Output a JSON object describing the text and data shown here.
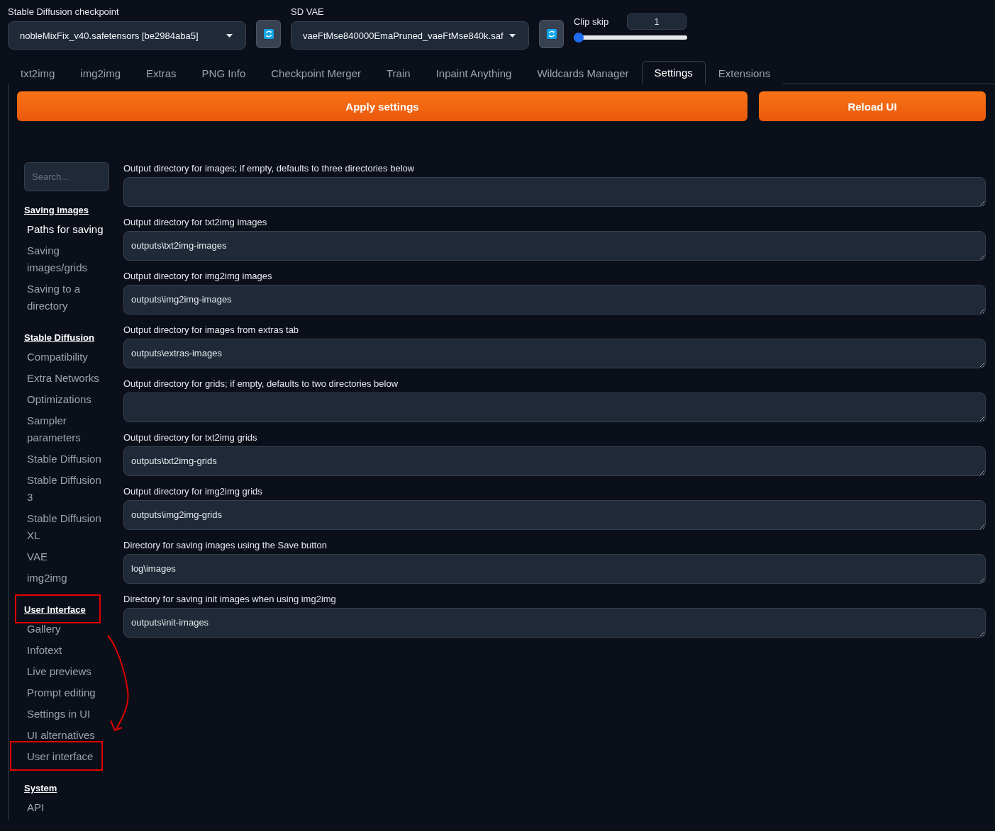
{
  "top_bar": {
    "checkpoint": {
      "label": "Stable Diffusion checkpoint",
      "value": "nobleMixFix_v40.safetensors [be2984aba5]"
    },
    "vae": {
      "label": "SD VAE",
      "value": "vaeFtMse840000EmaPruned_vaeFtMse840k.saf"
    },
    "clip_skip": {
      "label": "Clip skip",
      "value": "1",
      "level": 0.0
    }
  },
  "tabs": [
    {
      "label": "txt2img",
      "selected": false
    },
    {
      "label": "img2img",
      "selected": false
    },
    {
      "label": "Extras",
      "selected": false
    },
    {
      "label": "PNG Info",
      "selected": false
    },
    {
      "label": "Checkpoint Merger",
      "selected": false
    },
    {
      "label": "Train",
      "selected": false
    },
    {
      "label": "Inpaint Anything",
      "selected": false
    },
    {
      "label": "Wildcards Manager",
      "selected": false
    },
    {
      "label": "Settings",
      "selected": true
    },
    {
      "label": "Extensions",
      "selected": false
    }
  ],
  "buttons": [
    {
      "label": "Apply settings"
    },
    {
      "label": "Reload UI"
    }
  ],
  "sidebar": {
    "search": {
      "placeholder": "Search..."
    },
    "sections": [
      {
        "heading": "Saving images",
        "annotated": false,
        "items": [
          {
            "label": "Paths for saving",
            "selected": true,
            "annotated": false
          },
          {
            "label": "Saving images/grids",
            "selected": false,
            "annotated": false
          },
          {
            "label": "Saving to a directory",
            "selected": false,
            "annotated": false
          }
        ]
      },
      {
        "heading": "Stable Diffusion",
        "annotated": false,
        "items": [
          {
            "label": "Compatibility",
            "selected": false,
            "annotated": false
          },
          {
            "label": "Extra Networks",
            "selected": false,
            "annotated": false
          },
          {
            "label": "Optimizations",
            "selected": false,
            "annotated": false
          },
          {
            "label": "Sampler parameters",
            "selected": false,
            "annotated": false
          },
          {
            "label": "Stable Diffusion",
            "selected": false,
            "annotated": false
          },
          {
            "label": "Stable Diffusion 3",
            "selected": false,
            "annotated": false
          },
          {
            "label": "Stable Diffusion XL",
            "selected": false,
            "annotated": false
          },
          {
            "label": "VAE",
            "selected": false,
            "annotated": false
          },
          {
            "label": "img2img",
            "selected": false,
            "annotated": false
          }
        ]
      },
      {
        "heading": "User Interface",
        "annotated": true,
        "items": [
          {
            "label": "Gallery",
            "selected": false,
            "annotated": false
          },
          {
            "label": "Infotext",
            "selected": false,
            "annotated": false
          },
          {
            "label": "Live previews",
            "selected": false,
            "annotated": false
          },
          {
            "label": "Prompt editing",
            "selected": false,
            "annotated": false
          },
          {
            "label": "Settings in UI",
            "selected": false,
            "annotated": false
          },
          {
            "label": "UI alternatives",
            "selected": false,
            "annotated": false
          },
          {
            "label": "User interface",
            "selected": false,
            "annotated": true
          }
        ]
      },
      {
        "heading": "System",
        "annotated": false,
        "items": [
          {
            "label": "API",
            "selected": false,
            "annotated": false
          }
        ]
      }
    ]
  },
  "settings": [
    {
      "label": "Output directory for images; if empty, defaults to three directories below"
    },
    {
      "label": "Output directory for txt2img images",
      "value": "outputs\\txt2img-images"
    },
    {
      "label": "Output directory for img2img images",
      "value": "outputs\\img2img-images"
    },
    {
      "label": "Output directory for images from extras tab",
      "value": "outputs\\extras-images"
    },
    {
      "label": "Output directory for grids; if empty, defaults to two directories below"
    },
    {
      "label": "Output directory for txt2img grids",
      "value": "outputs\\txt2img-grids"
    },
    {
      "label": "Output directory for img2img grids",
      "value": "outputs\\img2img-grids"
    },
    {
      "label": "Directory for saving images using the Save button",
      "value": "log\\images"
    },
    {
      "label": "Directory for saving init images when using img2img",
      "value": "outputs\\init-images"
    }
  ]
}
